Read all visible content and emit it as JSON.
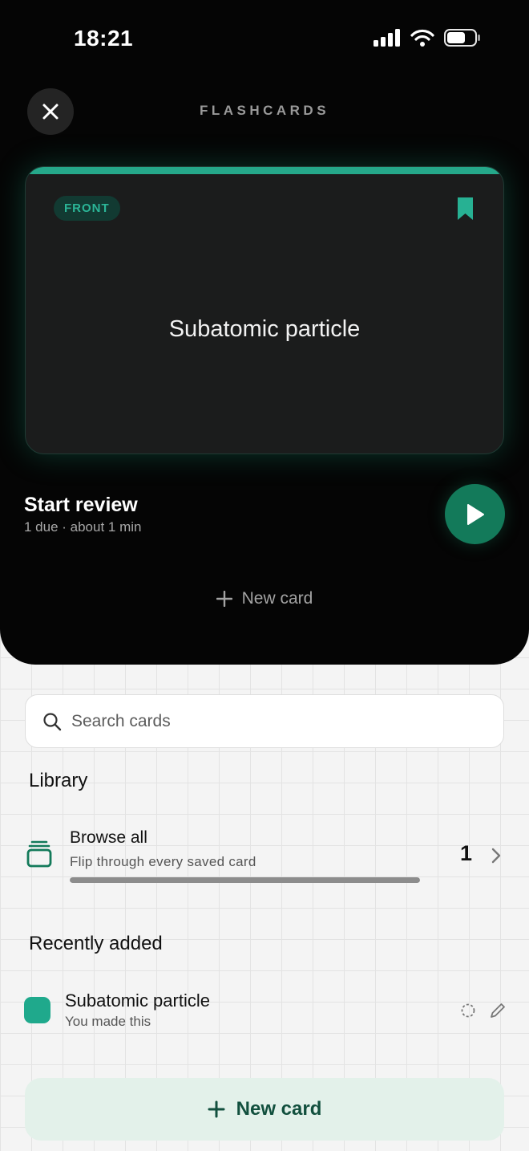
{
  "status_bar": {
    "time": "18:21"
  },
  "header": {
    "title": "FLASHCARDS",
    "close_icon": "close-icon"
  },
  "card": {
    "badge": "FRONT",
    "term": "Subatomic particle",
    "bookmark_icon": "bookmark-icon",
    "accent": "#25a88a"
  },
  "review": {
    "title": "Start review",
    "subtitle": "1 due · about 1 min",
    "play_icon": "play-icon"
  },
  "top_new_card": {
    "label": "New card",
    "icon": "plus-icon"
  },
  "search": {
    "placeholder": "Search cards",
    "value": "",
    "icon": "search-icon"
  },
  "library": {
    "heading": "Library",
    "browse_all": {
      "title": "Browse all",
      "subtitle": "Flip through every saved card",
      "count": "1",
      "progress": 1.0,
      "icon": "card-stack-icon"
    }
  },
  "recent": {
    "heading": "Recently added",
    "items": [
      {
        "title": "Subatomic particle",
        "subtitle": "You made this",
        "color": "#1fa98c",
        "status_icon": "dashed-circle-icon",
        "edit_icon": "pencil-icon"
      }
    ]
  },
  "bottom_button": {
    "label": "New card",
    "icon": "plus-icon"
  },
  "colors": {
    "brand_green": "#137a5a",
    "panel_bg": "#050505",
    "light_button_bg": "#e3f1ea"
  }
}
